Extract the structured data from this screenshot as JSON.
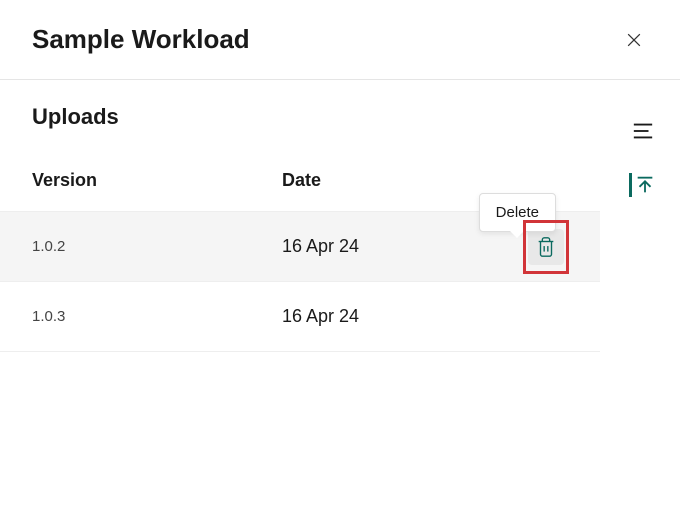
{
  "header": {
    "title": "Sample Workload"
  },
  "section": {
    "title": "Uploads"
  },
  "table": {
    "columns": {
      "version": "Version",
      "date": "Date"
    },
    "rows": [
      {
        "version": "1.0.2",
        "date": "16 Apr 24"
      },
      {
        "version": "1.0.3",
        "date": "16 Apr 24"
      }
    ]
  },
  "tooltip": {
    "delete": "Delete"
  }
}
